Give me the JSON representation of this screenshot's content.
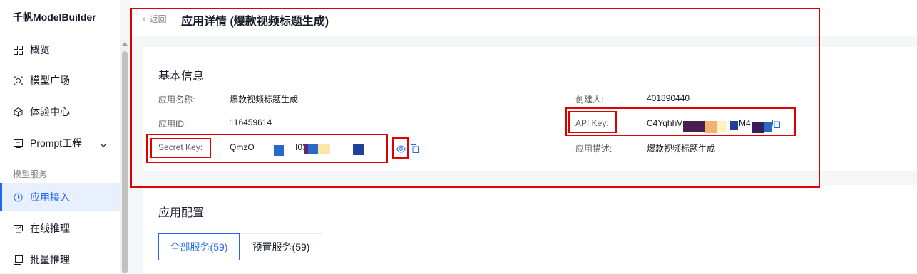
{
  "sidebar": {
    "title": "千帆ModelBuilder",
    "items": [
      {
        "label": "概览",
        "icon": "grid-icon"
      },
      {
        "label": "模型广场",
        "icon": "model-square-icon"
      },
      {
        "label": "体验中心",
        "icon": "cube-icon"
      },
      {
        "label": "Prompt工程",
        "icon": "prompt-icon"
      },
      {
        "label": "应用接入",
        "icon": "app-access-icon"
      },
      {
        "label": "在线推理",
        "icon": "monitor-icon"
      },
      {
        "label": "批量推理",
        "icon": "batch-icon"
      }
    ],
    "section_label": "模型服务"
  },
  "header": {
    "back_label": "返回",
    "title": "应用详情 (爆款视频标题生成)"
  },
  "basic_info": {
    "title": "基本信息",
    "app_name_label": "应用名称:",
    "app_name_value": "爆款视频标题生成",
    "app_id_label": "应用ID:",
    "app_id_value": "116459614",
    "secret_key_label": "Secret Key:",
    "secret_key_prefix": "QmzO",
    "secret_key_mid": "I03",
    "creator_label": "创建人:",
    "creator_value": "401890440",
    "api_key_label": "API Key:",
    "api_key_prefix": "C4YqhhV",
    "api_key_mid": "M4",
    "desc_label": "应用描述:",
    "desc_value": "爆款视频标题生成"
  },
  "app_config": {
    "title": "应用配置",
    "tabs": [
      {
        "label": "全部服务(59)",
        "active": true
      },
      {
        "label": "预置服务(59)",
        "active": false
      }
    ]
  },
  "colors": {
    "accent": "#2468f2",
    "highlight_box": "#e00000"
  }
}
